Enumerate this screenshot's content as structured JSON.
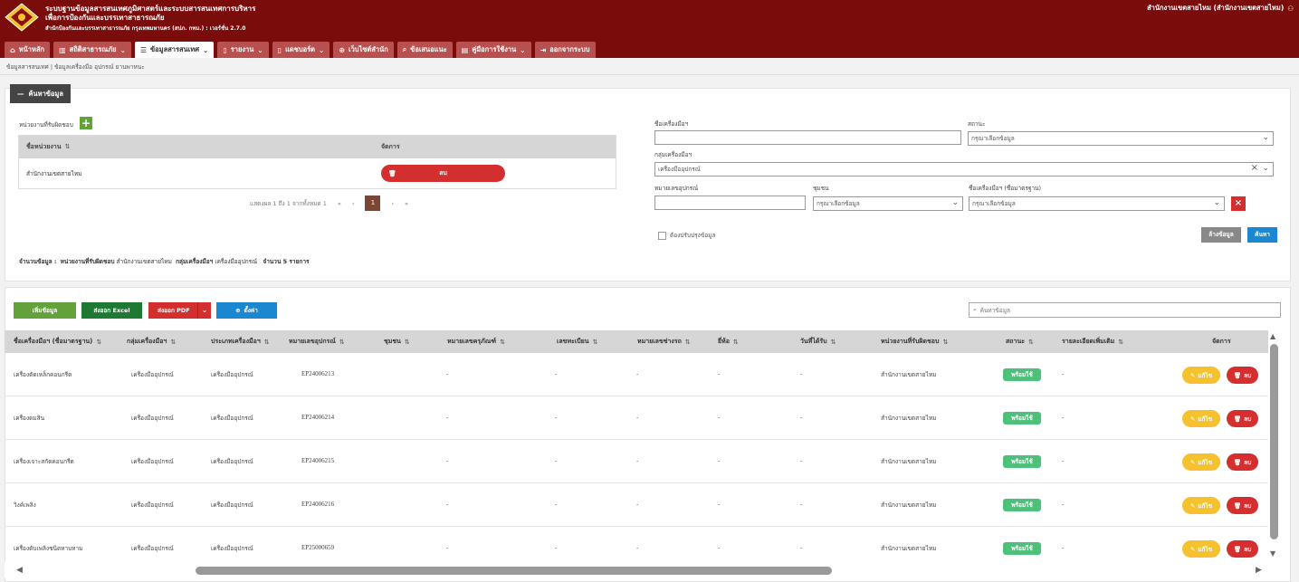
{
  "header": {
    "title_line1": "ระบบฐานข้อมูลสารสนเทศภูมิศาสตร์และระบบสารสนเทศการบริหาร",
    "title_line2": "เพื่อการป้องกันและบรรเทาสาธารณภัย",
    "subtitle": "สำนักป้องกันและบรรเทาสาธารณภัย กรุงเทพมหานคร (สปภ. กทม.) : เวอร์ชั่น 2.7.0",
    "user": "สำนักงานเขตสายไหม (สำนักงานเขตสายไหม)"
  },
  "nav": [
    {
      "label": "หน้าหลัก",
      "icon": "home-icon",
      "glyph": "⌂"
    },
    {
      "label": "สถิติสาธารณภัย",
      "icon": "chart-icon",
      "glyph": "▥",
      "dropdown": "⌄"
    },
    {
      "label": "ข้อมูลสารสนเทศ",
      "icon": "list-icon",
      "glyph": "☰",
      "dropdown": "⌄"
    },
    {
      "label": "รายงาน",
      "icon": "file-icon",
      "glyph": "▯",
      "dropdown": "⌄"
    },
    {
      "label": "แดชบอร์ด",
      "icon": "file-icon",
      "glyph": "▯",
      "dropdown": "⌄"
    },
    {
      "label": "เว็บไซต์สำนัก",
      "icon": "globe-icon",
      "glyph": "⊕"
    },
    {
      "label": "ข้อเสนอแนะ",
      "icon": "search-icon",
      "glyph": "⌕"
    },
    {
      "label": "คู่มือการใช้งาน",
      "icon": "book-icon",
      "glyph": "▤",
      "dropdown": "⌄"
    },
    {
      "label": "ออกจากระบบ",
      "icon": "logout-icon",
      "glyph": "⇥"
    }
  ],
  "breadcrumb": "ข้อมูลสารสนเทศ | ข้อมูลเครื่องมือ อุปกรณ์ ยานพาหนะ",
  "search_panel": {
    "tag": "ค้นหาข้อมูล",
    "unit_label": "หน่วยงานที่รับผิดชอบ",
    "unit_table": {
      "col1": "ชื่อหน่วยงาน",
      "col2": "จัดการ",
      "row_name": "สำนักงานเขตสายไหม",
      "delete_label": "ลบ"
    },
    "pager": {
      "info": "แสดงผล 1 ถึง 1 จากทั้งหมด 1",
      "first": "«",
      "prev": "‹",
      "page": "1",
      "next": "›",
      "last": "»"
    },
    "summary": {
      "prefix": "จำนวนข้อมูล :",
      "unit_label": "หน่วยงานที่รับผิดชอบ",
      "unit_value": "สำนักงานเขตสายไหม",
      "group_label": "กลุ่มเครื่องมือฯ",
      "group_value": "เครื่องมืออุปกรณ์",
      "count": "จำนวน 5 รายการ"
    },
    "fields": {
      "name_label": "ชื่อเครื่องมือฯ",
      "name_value": "",
      "status_label": "สถานะ",
      "status_placeholder": "กรุณาเลือกข้อมูล",
      "group_label": "กลุ่มเครื่องมือฯ",
      "group_value": "เครื่องมืออุปกรณ์",
      "code_label": "หมายเลขอุปกรณ์",
      "code_value": "",
      "community_label": "ชุมชน",
      "community_placeholder": "กรุณาเลือกข้อมูล",
      "standard_label": "ชื่อเครื่องมือฯ (ชื่อมาตรฐาน)",
      "standard_placeholder": "กรุณาเลือกข้อมูล"
    },
    "checkbox_label": "ต้องปรับปรุงข้อมูล",
    "clear_label": "ล้างข้อมูล",
    "search_label": "ค้นหา"
  },
  "toolbar": {
    "add_label": "เพิ่มข้อมูล",
    "excel_label": "ส่งออก Excel",
    "pdf_label": "ส่งออก PDF",
    "settings_label": "ตั้งค่า",
    "search_placeholder": "ค้นหาข้อมูล"
  },
  "table": {
    "columns": [
      "ชื่อเครื่องมือฯ (ชื่อมาตรฐาน)",
      "กลุ่มเครื่องมือฯ",
      "ประเภทเครื่องมือฯ",
      "หมายเลขอุปกรณ์",
      "ชุมชน",
      "หมายเลขครุภัณฑ์",
      "เลขทะเบียน",
      "หมายเลขช่างรถ",
      "ยี่ห้อ",
      "วันที่ได้รับ",
      "หน่วยงานที่รับผิดชอบ",
      "สถานะ",
      "รายละเอียดเพิ่มเติม",
      "จัดการ"
    ],
    "sort_glyph": "⇅",
    "edit_label": "แก้ไข",
    "delete_label": "ลบ",
    "rows": [
      {
        "name": "เครื่องตัดเหล็กคอนกรีต",
        "group": "เครื่องมืออุปกรณ์",
        "type": "เครื่องมืออุปกรณ์",
        "code": "EP24006213",
        "community": "",
        "asset": "-",
        "reg": "-",
        "chassis": "-",
        "brand": "-",
        "received": "-",
        "unit": "สำนักงานเขตสายไหม",
        "status": "พร้อมใช้",
        "detail": "-"
      },
      {
        "name": "เครื่องดมสิน",
        "group": "เครื่องมืออุปกรณ์",
        "type": "เครื่องมืออุปกรณ์",
        "code": "EP24006214",
        "community": "",
        "asset": "-",
        "reg": "-",
        "chassis": "-",
        "brand": "-",
        "received": "-",
        "unit": "สำนักงานเขตสายไหม",
        "status": "พร้อมใช้",
        "detail": "-"
      },
      {
        "name": "เครื่องเจาะสกัดคอนกรีต",
        "group": "เครื่องมืออุปกรณ์",
        "type": "เครื่องมืออุปกรณ์",
        "code": "EP24006215",
        "community": "",
        "asset": "-",
        "reg": "-",
        "chassis": "-",
        "brand": "-",
        "received": "-",
        "unit": "สำนักงานเขตสายไหม",
        "status": "พร้อมใช้",
        "detail": "-"
      },
      {
        "name": "วิงค์เพลิง",
        "group": "เครื่องมืออุปกรณ์",
        "type": "เครื่องมืออุปกรณ์",
        "code": "EP24006216",
        "community": "",
        "asset": "-",
        "reg": "-",
        "chassis": "-",
        "brand": "-",
        "received": "-",
        "unit": "สำนักงานเขตสายไหม",
        "status": "พร้อมใช้",
        "detail": "-"
      },
      {
        "name": "เครื่องดับเพลิงชนิดหาบหาม",
        "group": "เครื่องมืออุปกรณ์",
        "type": "เครื่องมืออุปกรณ์",
        "code": "EP25000659",
        "community": "",
        "asset": "-",
        "reg": "-",
        "chassis": "-",
        "brand": "-",
        "received": "-",
        "unit": "สำนักงานเขตสายไหม",
        "status": "พร้อมใช้",
        "detail": "-"
      }
    ]
  },
  "colors": {
    "header_bg": "#7b0c0c",
    "nav_tab": "#b8504f",
    "add_green": "#63a23a",
    "excel_green": "#1e7a32",
    "danger": "#d32f2f",
    "primary": "#1a87d0",
    "warning": "#f5c12e",
    "ready": "#4cc17a"
  }
}
